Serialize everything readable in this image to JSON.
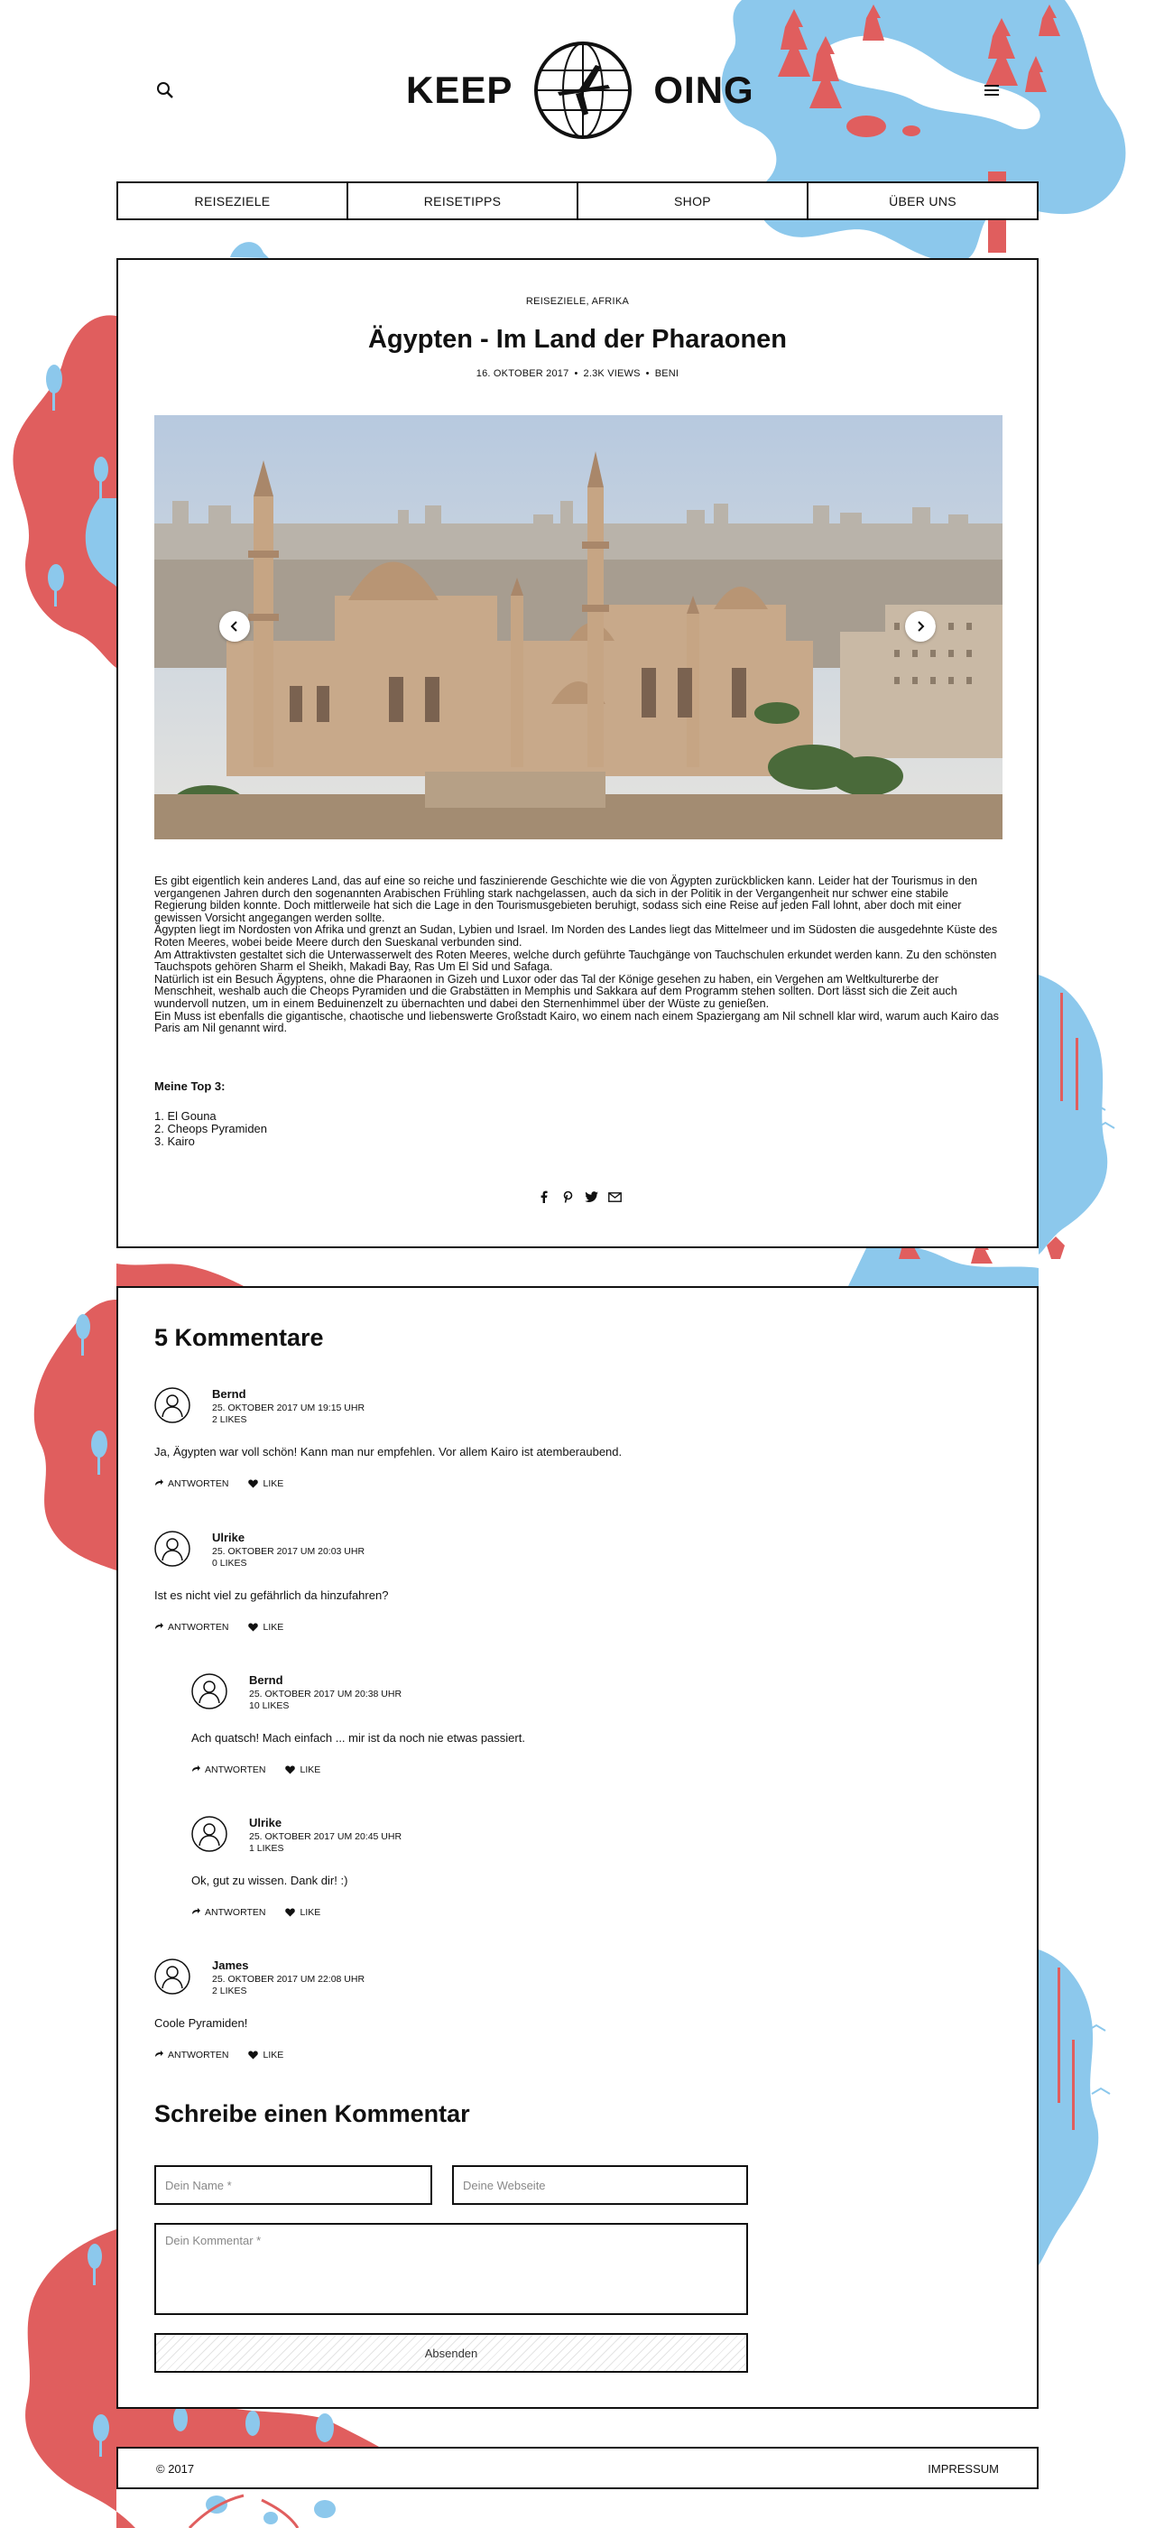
{
  "header": {
    "logo_left": "KEEP",
    "logo_right": "OING",
    "search_icon": "search-icon",
    "menu_icon": "hamburger-menu-icon"
  },
  "nav": {
    "items": [
      {
        "label": "REISEZIELE"
      },
      {
        "label": "REISETIPPS"
      },
      {
        "label": "SHOP"
      },
      {
        "label": "ÜBER UNS"
      }
    ]
  },
  "article": {
    "categories": "REISEZIELE, AFRIKA",
    "title": "Ägypten - Im Land der Pharaonen",
    "meta": {
      "date": "16. OKTOBER 2017",
      "views": "2.3K VIEWS",
      "author": "BENI",
      "separator": "•"
    },
    "paragraphs": [
      "Es gibt eigentlich kein anderes Land, das auf eine so reiche und faszinierende Geschichte wie die von Ägypten zurückblicken kann. Leider hat der Tourismus in den vergangenen Jahren durch den sogenannten Arabischen Frühling stark nachgelassen, auch da sich in der Politik in der Vergangenheit nur schwer eine stabile Regierung bilden konnte. Doch mittlerweile hat sich die Lage in den Tourismusgebieten beruhigt, sodass sich eine Reise auf jeden Fall lohnt, aber doch mit einer gewissen Vorsicht angegangen werden sollte.",
      "Ägypten liegt im Nordosten von Afrika und grenzt an Sudan, Lybien und Israel. Im Norden des Landes liegt das Mittelmeer und im Südosten die ausgedehnte Küste des Roten Meeres, wobei beide Meere durch den Sueskanal verbunden sind.",
      "Am Attraktivsten gestaltet sich die Unterwasserwelt des Roten Meeres, welche durch geführte Tauchgänge von Tauchschulen erkundet werden kann. Zu den schönsten Tauchspots gehören Sharm el Sheikh, Makadi Bay, Ras Um El Sid und Safaga.",
      "Natürlich ist ein Besuch Ägyptens, ohne die Pharaonen in Gizeh und Luxor oder das Tal der Könige gesehen zu haben, ein Vergehen am Weltkulturerbe der Menschheit, weshalb auch die Cheops Pyramiden und die Grabstätten in Memphis und Sakkara auf dem Programm stehen sollten. Dort lässt sich die Zeit auch wundervoll nutzen, um in einem Beduinenzelt zu übernachten und dabei den Sternenhimmel über der Wüste zu genießen.",
      "Ein Muss ist ebenfalls die gigantische, chaotische und liebenswerte Großstadt Kairo, wo einem nach einem Spaziergang am Nil schnell klar wird, warum auch Kairo das Paris am Nil genannt wird."
    ],
    "top3_title": "Meine Top 3:",
    "top3": [
      "1. El Gouna",
      "2. Cheops Pyramiden",
      "3. Kairo"
    ],
    "share_icons": [
      "facebook-icon",
      "pinterest-icon",
      "twitter-icon",
      "mail-icon"
    ]
  },
  "comments": {
    "heading": "5 Kommentare",
    "reply_label": "ANTWORTEN",
    "like_label": "LIKE",
    "list": [
      {
        "author": "Bernd",
        "date": "25. OKTOBER 2017 UM 19:15 UHR",
        "likes": "2 LIKES",
        "text": "Ja, Ägypten war voll schön! Kann man nur empfehlen. Vor allem Kairo ist atemberaubend."
      },
      {
        "author": "Ulrike",
        "date": "25. OKTOBER 2017 UM 20:03 UHR",
        "likes": "0 LIKES",
        "text": "Ist es nicht viel zu gefährlich da hinzufahren?"
      },
      {
        "author": "Bernd",
        "date": "25. OKTOBER 2017 UM 20:38 UHR",
        "likes": "10 LIKES",
        "text": "Ach quatsch! Mach einfach ... mir ist da noch nie etwas passiert."
      },
      {
        "author": "Ulrike",
        "date": "25. OKTOBER 2017 UM 20:45 UHR",
        "likes": "1 LIKES",
        "text": "Ok, gut zu wissen. Dank dir! :)"
      },
      {
        "author": "James",
        "date": "25. OKTOBER 2017 UM 22:08 UHR",
        "likes": "2 LIKES",
        "text": "Coole Pyramiden!"
      }
    ]
  },
  "form": {
    "title": "Schreibe einen Kommentar",
    "name_placeholder": "Dein Name *",
    "website_placeholder": "Deine Webseite",
    "comment_placeholder": "Dein Kommentar *",
    "submit_label": "Absenden"
  },
  "footer": {
    "copyright": "© 2017",
    "imprint": "IMPRESSUM"
  },
  "colors": {
    "blue": "#8cc8ec",
    "red": "#e05e5e",
    "border": "#111111"
  }
}
